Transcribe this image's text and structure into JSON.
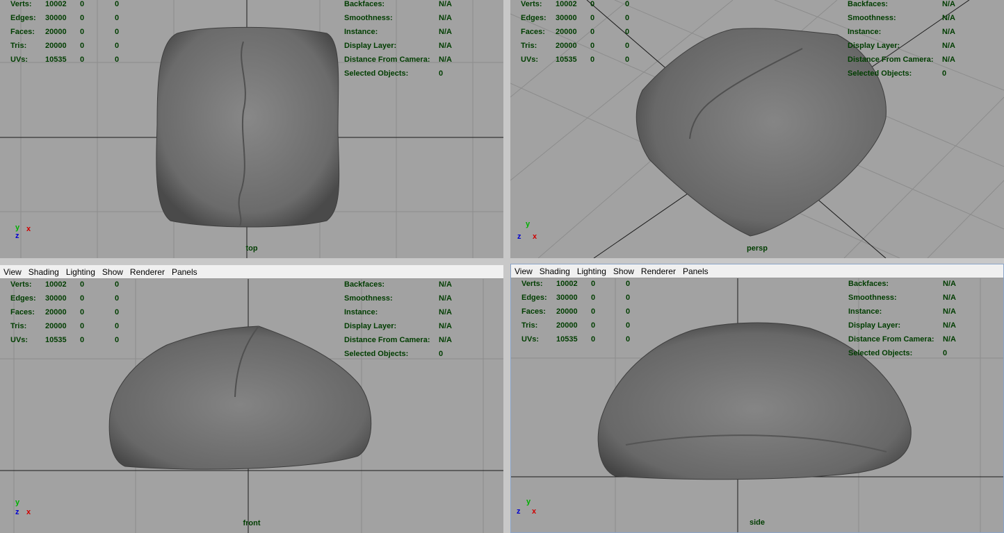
{
  "menu": [
    "View",
    "Shading",
    "Lighting",
    "Show",
    "Renderer",
    "Panels"
  ],
  "stats": [
    {
      "label": "Verts:",
      "v1": "10002",
      "v2": "0",
      "v3": "0"
    },
    {
      "label": "Edges:",
      "v1": "30000",
      "v2": "0",
      "v3": "0"
    },
    {
      "label": "Faces:",
      "v1": "20000",
      "v2": "0",
      "v3": "0"
    },
    {
      "label": "Tris:",
      "v1": "20000",
      "v2": "0",
      "v3": "0"
    },
    {
      "label": "UVs:",
      "v1": "10535",
      "v2": "0",
      "v3": "0"
    }
  ],
  "info": [
    {
      "label": "Backfaces:",
      "value": "N/A"
    },
    {
      "label": "Smoothness:",
      "value": "N/A"
    },
    {
      "label": "Instance:",
      "value": "N/A"
    },
    {
      "label": "Display Layer:",
      "value": "N/A"
    },
    {
      "label": "Distance From Camera:",
      "value": "N/A"
    },
    {
      "label": "Selected Objects:",
      "value": "0"
    }
  ],
  "cameras": {
    "top": "top",
    "persp": "persp",
    "front": "front",
    "side": "side"
  },
  "axes": {
    "x": "x",
    "y": "y",
    "z": "z"
  },
  "colors": {
    "viewport_bg": "#a2a2a2",
    "hud_text": "#003d00",
    "mesh": "#6e6e6e",
    "x_axis": "#d00000",
    "y_axis": "#00b000",
    "z_axis": "#0000d0"
  }
}
